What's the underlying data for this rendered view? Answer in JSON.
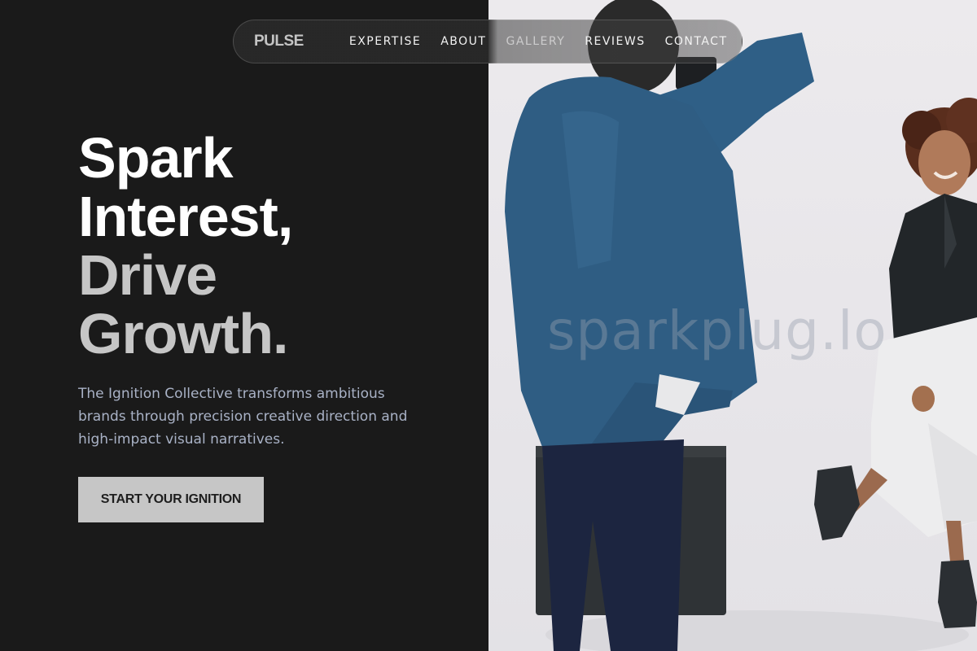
{
  "nav": {
    "logo": "PULSE",
    "links": [
      "EXPERTISE",
      "ABOUT",
      "GALLERY",
      "REVIEWS",
      "CONTACT"
    ]
  },
  "hero": {
    "headline_line1": "Spark",
    "headline_line2": "Interest,",
    "headline_line3": "Drive",
    "headline_line4": "Growth.",
    "subtitle": "The Ignition Collective transforms ambitious brands through precision creative direction and high-impact visual narratives.",
    "cta_label": "START YOUR IGNITION"
  },
  "watermark": "sparkplug.lo",
  "colors": {
    "background": "#1a1a1a",
    "headline_primary": "#ffffff",
    "headline_secondary": "#c6c6c6",
    "subtitle": "#a9b2c6",
    "cta_background": "#c6c6c6"
  }
}
